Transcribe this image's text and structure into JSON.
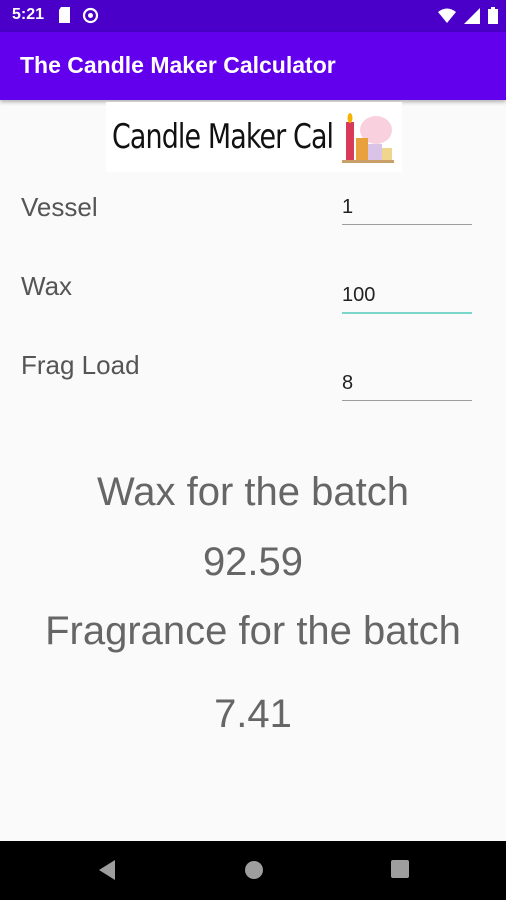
{
  "status": {
    "time": "5:21",
    "left_icons": [
      "sd-card-icon",
      "sync-icon"
    ],
    "right_icons": [
      "wifi-icon",
      "signal-icon",
      "battery-icon"
    ]
  },
  "app_bar": {
    "title": "The Candle Maker Calculator"
  },
  "logo": {
    "text": "Candle Maker Cal"
  },
  "fields": [
    {
      "label": "Vessel",
      "value": "1"
    },
    {
      "label": "Wax",
      "value": "100"
    },
    {
      "label": "Frag Load",
      "value": "8"
    }
  ],
  "results": {
    "wax_label": "Wax for the batch",
    "wax_value": "92.59",
    "fragrance_label": "Fragrance for the batch",
    "fragrance_value": "7.41"
  },
  "nav": {
    "buttons": [
      "back-icon",
      "home-icon",
      "recents-icon"
    ]
  },
  "colors": {
    "status_bar": "#4a00c9",
    "app_bar": "#6200ee",
    "focus_underline": "#7bd6cc",
    "background": "#fafafa"
  }
}
